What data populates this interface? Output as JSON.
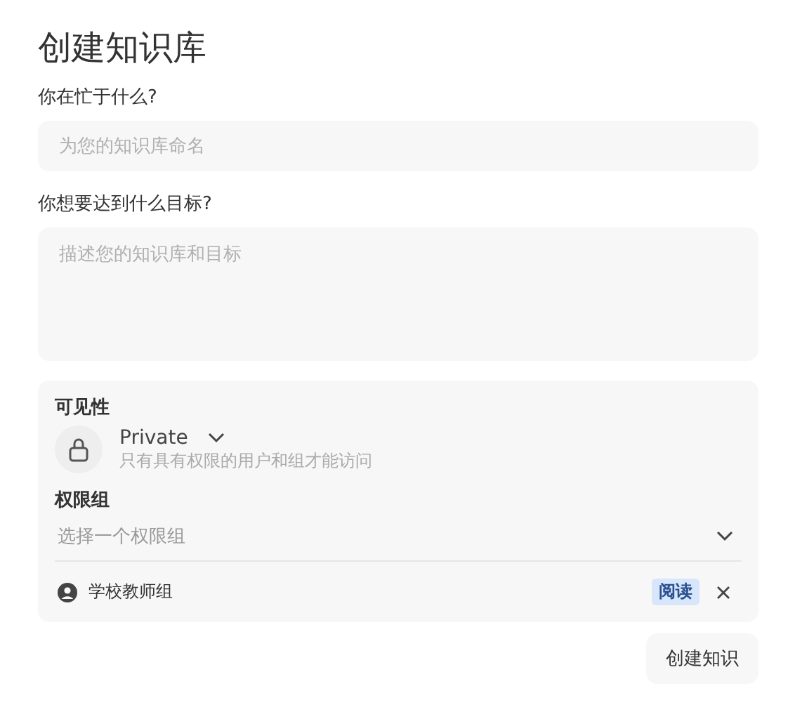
{
  "title": "创建知识库",
  "name_field": {
    "label": "你在忙于什么?",
    "placeholder": "为您的知识库命名"
  },
  "goal_field": {
    "label": "你想要达到什么目标?",
    "placeholder": "描述您的知识库和目标"
  },
  "visibility": {
    "label": "可见性",
    "value": "Private",
    "description": "只有具有权限的用户和组才能访问"
  },
  "permission_groups": {
    "label": "权限组",
    "placeholder": "选择一个权限组",
    "groups": [
      {
        "name": "学校教师组",
        "permission": "阅读"
      }
    ]
  },
  "submit_button": "创建知识"
}
